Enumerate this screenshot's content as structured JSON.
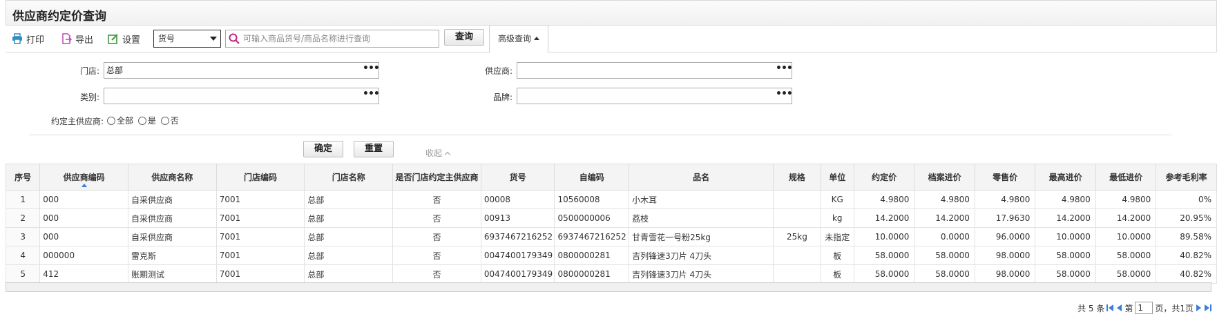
{
  "page": {
    "title": "供应商约定价查询"
  },
  "toolbar": {
    "print_label": "打印",
    "export_label": "导出",
    "settings_label": "设置",
    "search_field_selected": "货号",
    "search_placeholder": "可输入商品货号/商品名称进行查询",
    "query_label": "查询",
    "advanced_label": "高级查询"
  },
  "filters": {
    "store_label": "门店:",
    "store_value": "总部",
    "supplier_label": "供应商:",
    "supplier_value": "",
    "category_label": "类别:",
    "category_value": "",
    "brand_label": "品牌:",
    "brand_value": "",
    "main_supplier_label": "约定主供应商:",
    "radio_all": "全部",
    "radio_yes": "是",
    "radio_no": "否",
    "confirm_label": "确定",
    "reset_label": "重置",
    "collapse_label": "收起"
  },
  "grid": {
    "columns": [
      "序号",
      "供应商编码",
      "供应商名称",
      "门店编码",
      "门店名称",
      "是否门店约定主供应商",
      "货号",
      "自编码",
      "品名",
      "规格",
      "单位",
      "约定价",
      "档案进价",
      "零售价",
      "最高进价",
      "最低进价",
      "参考毛利率"
    ],
    "rows": [
      [
        "1",
        "000",
        "自采供应商",
        "7001",
        "总部",
        "否",
        "00008",
        "10560008",
        "小木耳",
        "",
        "KG",
        "4.9800",
        "4.9800",
        "4.9800",
        "4.9800",
        "4.9800",
        "0%"
      ],
      [
        "2",
        "000",
        "自采供应商",
        "7001",
        "总部",
        "否",
        "00913",
        "0500000006",
        "荔枝",
        "",
        "kg",
        "14.2000",
        "14.2000",
        "17.9630",
        "14.2000",
        "14.2000",
        "20.95%"
      ],
      [
        "3",
        "000",
        "自采供应商",
        "7001",
        "总部",
        "否",
        "6937467216252",
        "6937467216252",
        "甘青雪花一号粉25kg",
        "25kg",
        "未指定",
        "10.0000",
        "0.0000",
        "96.0000",
        "10.0000",
        "10.0000",
        "89.58%"
      ],
      [
        "4",
        "000000",
        "雷克斯",
        "7001",
        "总部",
        "否",
        "0047400179349",
        "0800000281",
        "吉列锋速3刀片 4刀头",
        "",
        "板",
        "58.0000",
        "58.0000",
        "98.0000",
        "58.0000",
        "58.0000",
        "40.82%"
      ],
      [
        "5",
        "412",
        "账期测试",
        "7001",
        "总部",
        "否",
        "0047400179349",
        "0800000281",
        "吉列锋速3刀片 4刀头",
        "",
        "板",
        "58.0000",
        "58.0000",
        "98.0000",
        "58.0000",
        "58.0000",
        "40.82%"
      ]
    ]
  },
  "pager": {
    "total_text": "共 5 条",
    "page_prefix": "第",
    "current_page": "1",
    "page_suffix": "页，共1页"
  },
  "colors": {
    "accent": "#3b7dd8",
    "print_icon": "#2b8fc9",
    "export_icon": "#c248b8",
    "settings_icon": "#3a9a3a",
    "search_icon": "#c0267e"
  }
}
